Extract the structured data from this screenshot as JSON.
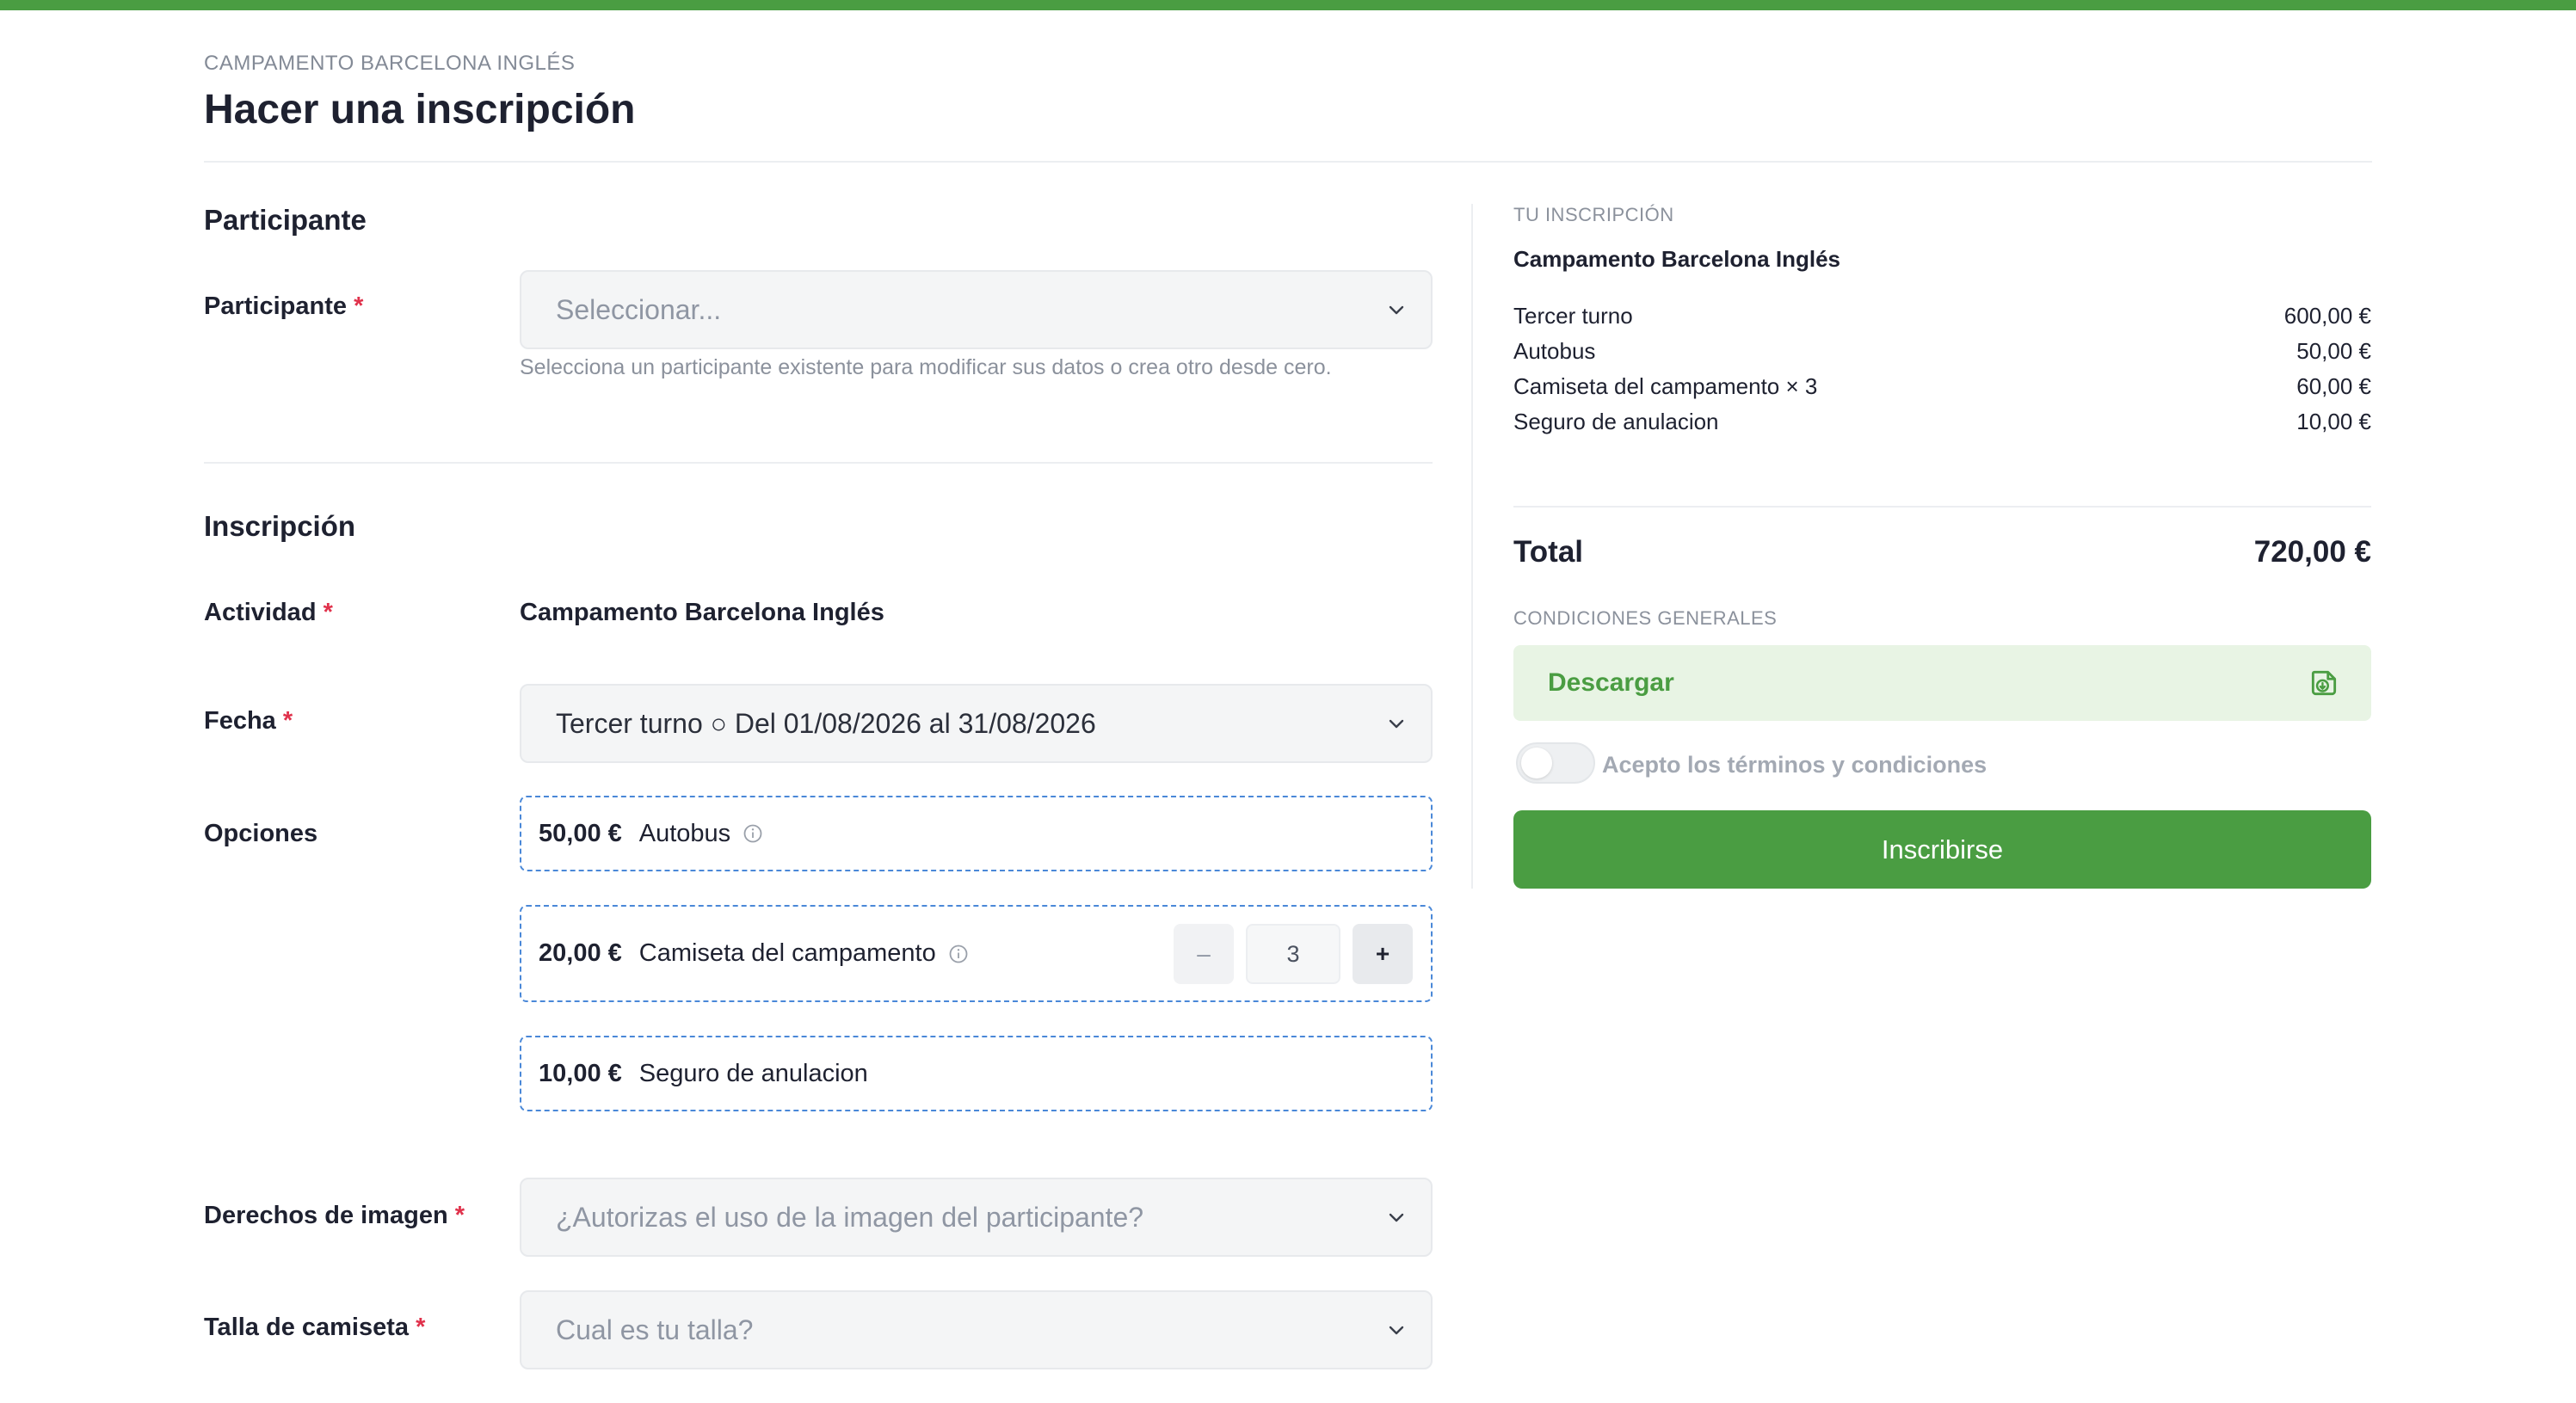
{
  "header": {
    "eyebrow": "CAMPAMENTO BARCELONA INGLÉS",
    "title": "Hacer una inscripción"
  },
  "participant_section": {
    "title": "Participante",
    "field_label": "Participante",
    "required_mark": "*",
    "select_placeholder": "Seleccionar...",
    "help": "Selecciona un participante existente para modificar sus datos o crea otro desde cero."
  },
  "registration_section": {
    "title": "Inscripción",
    "activity_label": "Actividad",
    "activity_value": "Campamento Barcelona Inglés",
    "date_label": "Fecha",
    "date_value": "Tercer turno ○ Del 01/08/2026 al 31/08/2026",
    "options_label": "Opciones",
    "options": [
      {
        "price": "50,00 €",
        "name": "Autobus",
        "has_info": true
      },
      {
        "price": "20,00 €",
        "name": "Camiseta del campamento",
        "has_info": true,
        "quantity": "3",
        "minus": "–",
        "plus": "+"
      },
      {
        "price": "10,00 €",
        "name": "Seguro de anulacion",
        "has_info": false
      }
    ],
    "image_rights_label": "Derechos de imagen",
    "image_rights_placeholder": "¿Autorizas el uso de la imagen del participante?",
    "tshirt_label": "Talla de camiseta",
    "tshirt_placeholder": "Cual es tu talla?"
  },
  "summary": {
    "eyebrow": "TU INSCRIPCIÓN",
    "activity": "Campamento Barcelona Inglés",
    "items": [
      {
        "label": "Tercer turno",
        "amount": "600,00 €"
      },
      {
        "label": "Autobus",
        "amount": "50,00 €"
      },
      {
        "label": "Camiseta del campamento × 3",
        "amount": "60,00 €"
      },
      {
        "label": "Seguro de anulacion",
        "amount": "10,00 €"
      }
    ],
    "total_label": "Total",
    "total_value": "720,00 €",
    "conditions_eyebrow": "CONDICIONES GENERALES",
    "download_label": "Descargar",
    "terms_label": "Acepto los términos y condiciones",
    "terms_accepted": false,
    "submit_label": "Inscribirse"
  },
  "colors": {
    "brand_green": "#4a9d42",
    "download_bg": "#e8f4e4",
    "required_red": "#e0314b",
    "option_border_blue": "#4a88d8"
  }
}
